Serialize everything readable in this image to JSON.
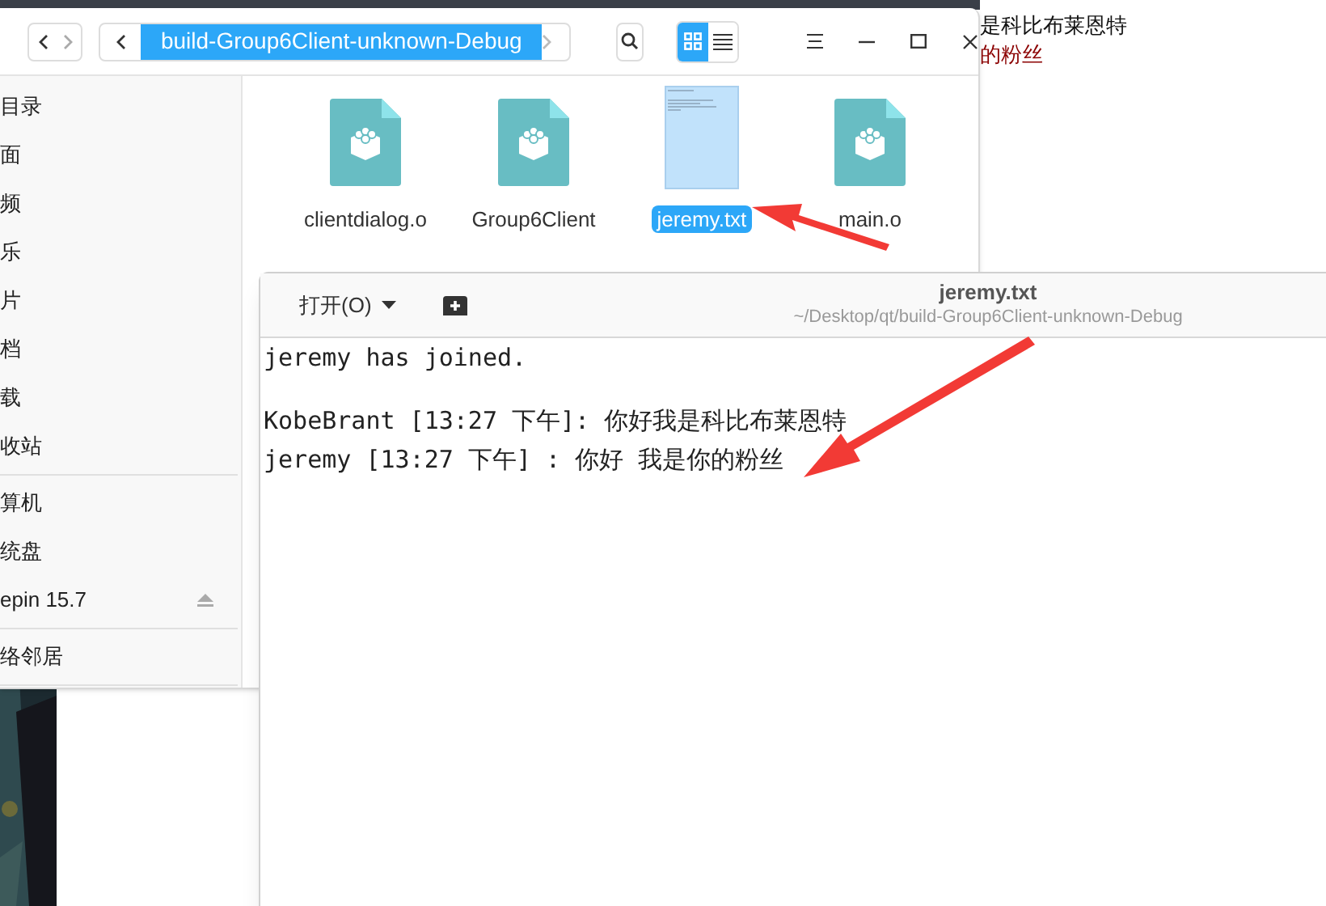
{
  "desktop_text": [
    {
      "text": "是科比布莱恩特",
      "color": "#111111"
    },
    {
      "text": "的粉丝",
      "color": "#8b0000"
    }
  ],
  "file_manager": {
    "breadcrumb": "build-Group6Client-unknown-Debug",
    "view_modes": [
      {
        "kind": "grid",
        "selected": true
      },
      {
        "kind": "list",
        "selected": false
      }
    ],
    "sidebar": {
      "items": [
        {
          "label": "目录",
          "kind": "place"
        },
        {
          "label": "面",
          "kind": "place"
        },
        {
          "label": "频",
          "kind": "place"
        },
        {
          "label": "乐",
          "kind": "place"
        },
        {
          "label": "片",
          "kind": "place"
        },
        {
          "label": "档",
          "kind": "place"
        },
        {
          "label": "载",
          "kind": "place"
        },
        {
          "label": "收站",
          "kind": "place"
        },
        {
          "label": "算机",
          "kind": "divider_before"
        },
        {
          "label": "统盘",
          "kind": "place"
        },
        {
          "label": "epin 15.7",
          "kind": "disk"
        },
        {
          "label": "络邻居",
          "kind": "divider_before"
        }
      ]
    },
    "files": [
      {
        "name": "clientdialog.o",
        "kind": "object",
        "selected": false
      },
      {
        "name": "Group6Client",
        "kind": "object",
        "selected": false
      },
      {
        "name": "jeremy.txt",
        "kind": "text",
        "selected": true
      },
      {
        "name": "main.o",
        "kind": "object",
        "selected": false
      }
    ]
  },
  "editor": {
    "open_button": "打开(O)",
    "title": "jeremy.txt",
    "path": "~/Desktop/qt/build-Group6Client-unknown-Debug",
    "paragraphs": [
      [
        "jeremy has joined."
      ],
      [
        "KobeBrant [13:27 下午]: 你好我是科比布莱恩特",
        "jeremy [13:27 下午] : 你好 我是你的粉丝"
      ]
    ]
  }
}
